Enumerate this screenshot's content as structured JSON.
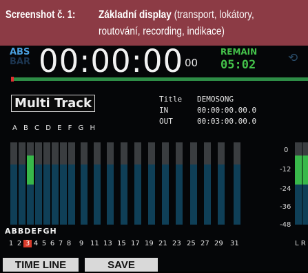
{
  "caption": {
    "label": "Screenshot č. 1:",
    "heading": "Základní display",
    "detail_line1": "(transport, lokátory,",
    "detail_line2": "routování, recording, indikace)"
  },
  "display": {
    "abs_label": "ABS",
    "bar_label": "BAR",
    "time": "00:00:00",
    "frames": "00",
    "remain_label": "REMAIN",
    "remain_value": "05:02",
    "repeat_icon": "repeat-icon",
    "mode": "Multi Track",
    "title_label": "Title",
    "title_value": "DEMOSONG",
    "in_label": "IN",
    "in_value": "00:00:00.00.0",
    "out_label": "OUT",
    "out_value": "00:03:00.00.0",
    "bus_letters": "A B C D E F G H",
    "assign_letters": "ABBDEFGH",
    "selected_track": "3",
    "track_numbers": [
      "1",
      "2",
      "3",
      "4",
      "5",
      "6",
      "7",
      "8",
      "9",
      "11",
      "13",
      "15",
      "17",
      "19",
      "21",
      "23",
      "25",
      "27",
      "29",
      "31"
    ],
    "scale": [
      "0",
      "-12",
      "-24",
      "-36",
      "-48"
    ],
    "master_labels": "L R",
    "meter_levels": [
      0,
      0,
      0.35,
      0,
      0,
      0,
      0,
      0,
      0,
      0,
      0,
      0,
      0,
      0,
      0,
      0,
      0,
      0,
      0,
      0
    ],
    "master_levels": [
      0.35,
      0.35
    ]
  },
  "buttons": {
    "timeline": "TIME LINE",
    "save": "SAVE"
  },
  "colors": {
    "caption_bg": "#8c3b45",
    "accent_blue": "#4aa0e0",
    "remain_green": "#44c24a",
    "selected_red": "#d93a2a"
  }
}
